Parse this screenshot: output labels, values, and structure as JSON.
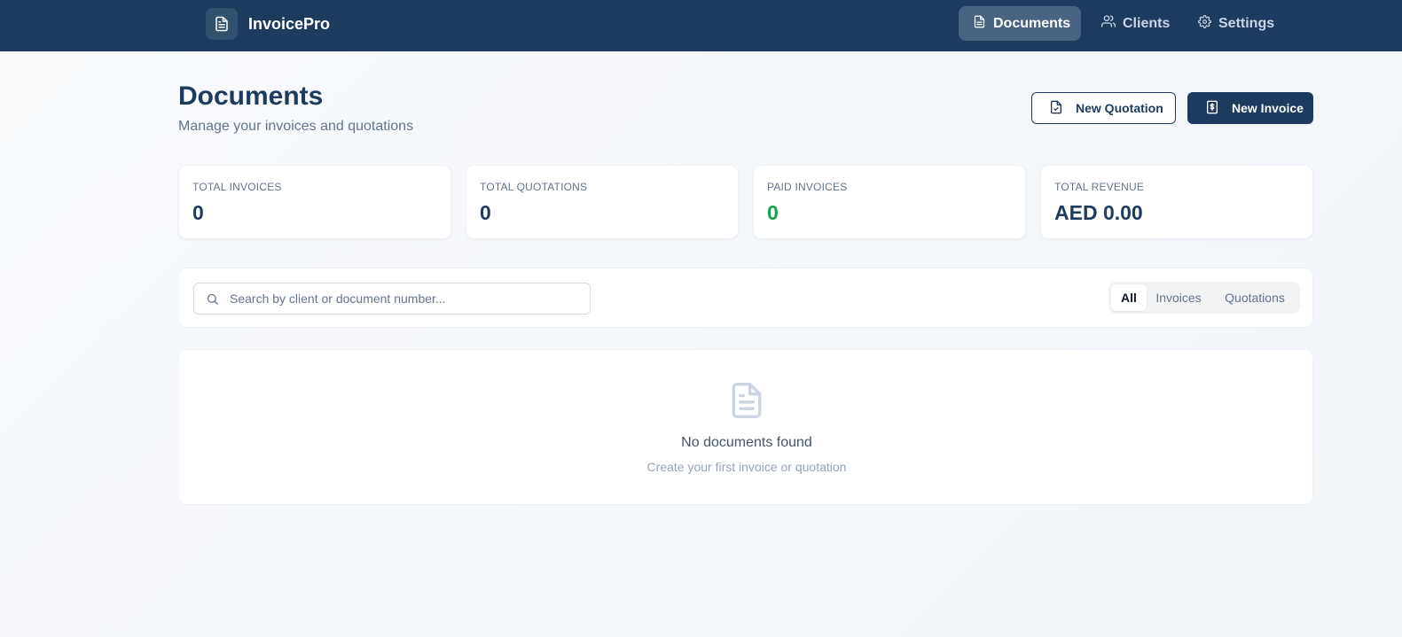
{
  "app": {
    "name": "InvoicePro",
    "icon": "file-text-icon"
  },
  "nav": {
    "documents": {
      "label": "Documents",
      "icon": "file-text-icon",
      "active": true
    },
    "clients": {
      "label": "Clients",
      "icon": "users-icon"
    },
    "settings": {
      "label": "Settings",
      "icon": "gear-icon"
    }
  },
  "page": {
    "title": "Documents",
    "subtitle": "Manage your invoices and quotations"
  },
  "actions": {
    "new_quotation": {
      "label": "New Quotation",
      "icon": "file-check-icon"
    },
    "new_invoice": {
      "label": "New Invoice",
      "icon": "receipt-dollar-icon"
    }
  },
  "stats": [
    {
      "label": "TOTAL INVOICES",
      "value": "0"
    },
    {
      "label": "TOTAL QUOTATIONS",
      "value": "0"
    },
    {
      "label": "PAID INVOICES",
      "value": "0",
      "color": "#16a34a"
    },
    {
      "label": "TOTAL REVENUE",
      "value": "AED 0.00"
    }
  ],
  "search": {
    "placeholder": "Search by client or document number...",
    "value": ""
  },
  "filters": {
    "selected": "All",
    "options": [
      "All",
      "Invoices",
      "Quotations"
    ]
  },
  "empty": {
    "title": "No documents found",
    "subtitle": "Create your first invoice or quotation",
    "icon": "file-text-icon"
  },
  "colors": {
    "brand": "#1e3a5f",
    "success": "#16a34a",
    "background": "#f8fafc"
  }
}
